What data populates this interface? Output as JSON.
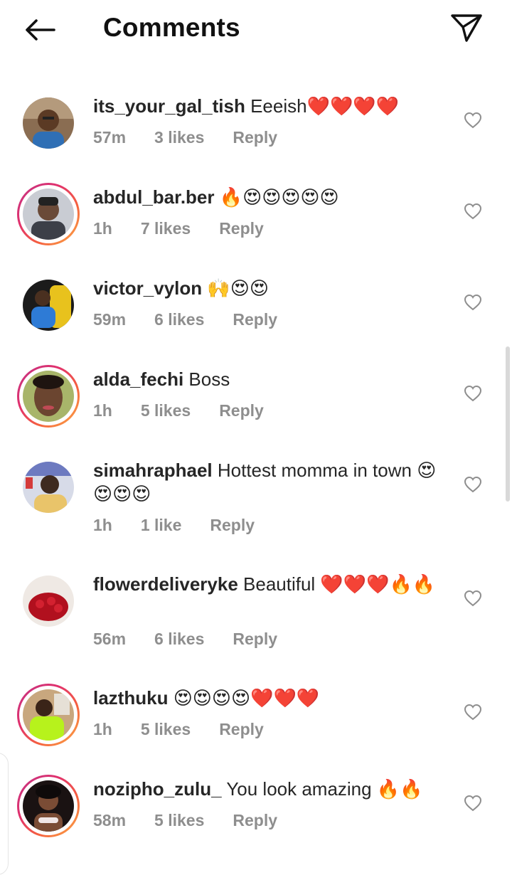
{
  "header": {
    "title": "Comments",
    "back_icon": "arrow-left-icon",
    "share_icon": "paper-plane-icon"
  },
  "colors": {
    "meta_gray": "#8e8e8e",
    "text": "#262626",
    "story_ring": [
      "#c13584",
      "#e1306c",
      "#f56040",
      "#fcaf45"
    ]
  },
  "comments": [
    {
      "username": "its_your_gal_tish",
      "text": "Eeeish❤️❤️❤️❤️",
      "time": "57m",
      "likes": "3 likes",
      "reply": "Reply",
      "story_ring": false
    },
    {
      "username": "abdul_bar.ber",
      "text": "🔥😍😍😍😍😍",
      "time": "1h",
      "likes": "7 likes",
      "reply": "Reply",
      "story_ring": true
    },
    {
      "username": "victor_vylon",
      "text": "🙌😍😍",
      "time": "59m",
      "likes": "6 likes",
      "reply": "Reply",
      "story_ring": false
    },
    {
      "username": "alda_fechi",
      "text": "Boss",
      "time": "1h",
      "likes": "5 likes",
      "reply": "Reply",
      "story_ring": true
    },
    {
      "username": "simahraphael",
      "text": "Hottest momma in town 😍😍😍😍",
      "time": "1h",
      "likes": "1 like",
      "reply": "Reply",
      "story_ring": false
    },
    {
      "username": "flowerdeliveryke",
      "text": "Beautiful ❤️❤️❤️🔥🔥",
      "time": "56m",
      "likes": "6 likes",
      "reply": "Reply",
      "story_ring": false
    },
    {
      "username": "lazthuku",
      "text": "😍😍😍😍❤️❤️❤️",
      "time": "1h",
      "likes": "5 likes",
      "reply": "Reply",
      "story_ring": true
    },
    {
      "username": "nozipho_zulu_",
      "text": "You look amazing 🔥🔥",
      "time": "58m",
      "likes": "5 likes",
      "reply": "Reply",
      "story_ring": true
    }
  ]
}
